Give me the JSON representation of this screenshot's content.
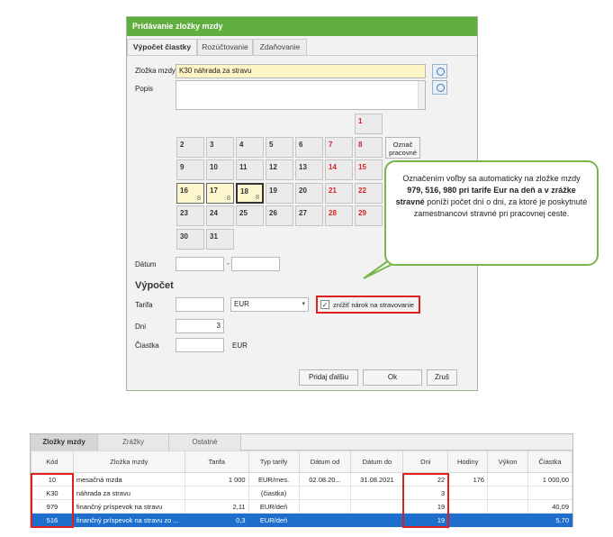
{
  "dialog": {
    "title": "Pridávanie zložky mzdy",
    "tabs": [
      "Výpočet čiastky",
      "Rozúčtovanie",
      "Zdaňovanie"
    ],
    "zlozka_label": "Zložka mzdy",
    "zlozka_value": "K30  náhrada za stravu",
    "popis_label": "Popis",
    "oznac_label": "Označ pracovné",
    "datum_label": "Dátum",
    "datum_sep": "-",
    "vypocet_heading": "Výpočet",
    "tarifa_label": "Tarifa",
    "currency_value": "EUR",
    "checkbox_label": "znížiť nárok na stravovanie",
    "checkbox_mark": "✓",
    "dni_label": "Dni",
    "dni_value": "3",
    "ciastka_label": "Čiastka",
    "ciastka_unit": "EUR",
    "buttons": {
      "add_next": "Pridaj ďalšiu",
      "ok": "Ok",
      "cancel": "Zruš"
    },
    "calendar": {
      "d1": "1",
      "d2": "2",
      "d3": "3",
      "d4": "4",
      "d5": "5",
      "d6": "6",
      "d7": "7",
      "d8": "8",
      "d9": "9",
      "d10": "10",
      "d11": "11",
      "d12": "12",
      "d13": "13",
      "d14": "14",
      "d15": "15",
      "d16": "16",
      "d17": "17",
      "d18": "18",
      "d19": "19",
      "d20": "20",
      "d21": "21",
      "d22": "22",
      "d23": "23",
      "d24": "24",
      "d25": "25",
      "d26": "26",
      "d27": "27",
      "d28": "28",
      "d29": "29",
      "d30": "30",
      "d31": "31",
      "hours": "8"
    }
  },
  "callout": {
    "part1": "Označením voľby sa automaticky na zložke mzdy ",
    "bold1": "979, 516, 980 pri tarife Eur na deň a v zrážke stravné",
    "part2": " poníži počet dní o dni, za ktoré je poskytnuté zamestnancovi stravné pri pracovnej ceste."
  },
  "grid": {
    "tabs": [
      "Zložky mzdy",
      "Zrážky",
      "Ostatné"
    ],
    "columns": [
      "Kód",
      "Zložka mzdy",
      "Tarifa",
      "Typ tarify",
      "Dátum od",
      "Dátum do",
      "Dni",
      "Hodiny",
      "Výkon",
      "Čiastka"
    ],
    "rows": [
      [
        "10",
        "mesačná mzda",
        "1 000",
        "EUR/mes.",
        "02.08.20...",
        "31.08.2021",
        "22",
        "176",
        "",
        "1 000,00"
      ],
      [
        "K30",
        "náhrada za stravu",
        "",
        "(čiastka)",
        "",
        "",
        "3",
        "",
        "",
        ""
      ],
      [
        "979",
        "finančný príspevok na stravu",
        "2,11",
        "EUR/deň",
        "",
        "",
        "19",
        "",
        "",
        "40,09"
      ],
      [
        "516",
        "finančný príspevok na stravu zo ...",
        "0,3",
        "EUR/deň",
        "",
        "",
        "19",
        "",
        "",
        "5,70"
      ]
    ]
  }
}
